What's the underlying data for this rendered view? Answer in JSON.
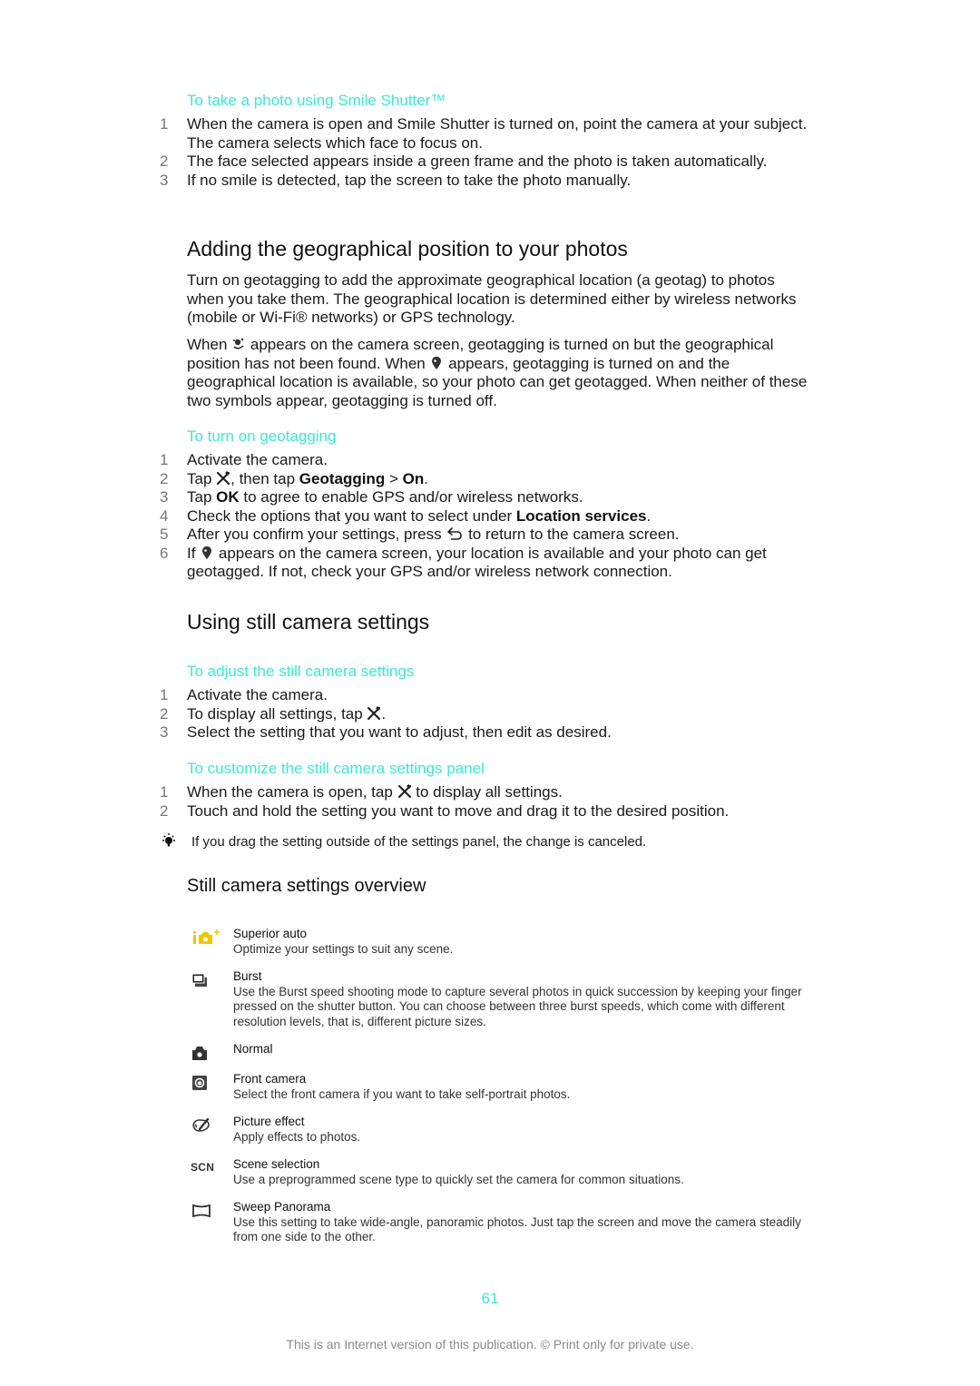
{
  "smile_shutter": {
    "heading": "To take a photo using Smile Shutter™",
    "steps": [
      {
        "num": "1",
        "text": "When the camera is open and Smile Shutter is turned on, point the camera at your subject. The camera selects which face to focus on."
      },
      {
        "num": "2",
        "text": "The face selected appears inside a green frame and the photo is taken automatically."
      },
      {
        "num": "3",
        "text": "If no smile is detected, tap the screen to take the photo manually."
      }
    ]
  },
  "geo_section": {
    "title": "Adding the geographical position to your photos",
    "para1": "Turn on geotagging to add the approximate geographical location (a geotag) to photos when you take them. The geographical location is determined either by wireless networks (mobile or Wi-Fi® networks) or GPS technology.",
    "para2_a": "When ",
    "para2_icon1": "geotag-searching-icon",
    "para2_b": " appears on the camera screen, geotagging is turned on but the geographical position has not been found. When ",
    "para2_icon2": "geotag-found-icon",
    "para2_c": " appears, geotagging is turned on and the geographical location is available, so your photo can get geotagged. When neither of these two symbols appear, geotagging is turned off."
  },
  "turn_on_geo": {
    "heading": "To turn on geotagging",
    "steps": [
      {
        "num": "1",
        "text": "Activate the camera."
      },
      {
        "num": "2",
        "a": "Tap ",
        "icon": "settings-icon",
        "b": ", then tap ",
        "bold1": "Geotagging",
        "c": " > ",
        "bold2": "On",
        "d": "."
      },
      {
        "num": "3",
        "a": "Tap ",
        "bold1": "OK",
        "b": " to agree to enable GPS and/or wireless networks."
      },
      {
        "num": "4",
        "a": "Check the options that you want to select under ",
        "bold1": "Location services",
        "b": "."
      },
      {
        "num": "5",
        "a": "After you confirm your settings, press ",
        "icon": "back-icon",
        "b": " to return to the camera screen."
      },
      {
        "num": "6",
        "a": "If ",
        "icon": "geotag-found-icon",
        "b": " appears on the camera screen, your location is available and your photo can get geotagged. If not, check your GPS and/or wireless network connection."
      }
    ]
  },
  "still_settings": {
    "title": "Using still camera settings",
    "adjust": {
      "heading": "To adjust the still camera settings",
      "steps": [
        {
          "num": "1",
          "text": "Activate the camera."
        },
        {
          "num": "2",
          "a": "To display all settings, tap ",
          "icon": "settings-icon",
          "b": "."
        },
        {
          "num": "3",
          "text": "Select the setting that you want to adjust, then edit as desired."
        }
      ]
    },
    "customize": {
      "heading": "To customize the still camera settings panel",
      "steps": [
        {
          "num": "1",
          "a": "When the camera is open, tap ",
          "icon": "settings-icon",
          "b": " to display all settings."
        },
        {
          "num": "2",
          "text": "Touch and hold the setting you want to move and drag it to the desired position."
        }
      ]
    },
    "tip": {
      "icon": "tip-lightbulb-icon",
      "text": "If you drag the setting outside of the settings panel, the change is canceled."
    }
  },
  "overview": {
    "title": "Still camera settings overview",
    "items": [
      {
        "icon": "superior-auto-icon",
        "name": "Superior auto",
        "desc": "Optimize your settings to suit any scene."
      },
      {
        "icon": "burst-icon",
        "name": "Burst",
        "desc": "Use the Burst speed shooting mode to capture several photos in quick succession by keeping your finger pressed on the shutter button. You can choose between three burst speeds, which come with different resolution levels, that is, different picture sizes."
      },
      {
        "icon": "normal-camera-icon",
        "name": "Normal",
        "desc": ""
      },
      {
        "icon": "front-camera-icon",
        "name": "Front camera",
        "desc": "Select the front camera if you want to take self-portrait photos."
      },
      {
        "icon": "picture-effect-icon",
        "name": "Picture effect",
        "desc": "Apply effects to photos."
      },
      {
        "icon": "scene-selection-icon",
        "name": "Scene selection",
        "desc": "Use a preprogrammed scene type to quickly set the camera for common situations.",
        "icon_text": "SCN"
      },
      {
        "icon": "sweep-panorama-icon",
        "name": "Sweep Panorama",
        "desc": "Use this setting to take wide-angle, panoramic photos. Just tap the screen and move the camera steadily from one side to the other."
      }
    ]
  },
  "footer": {
    "page_number": "61",
    "notice": "This is an Internet version of this publication. © Print only for private use."
  },
  "colors": {
    "accent": "#3ee6d6",
    "superior_auto_icon": "#f5c400"
  }
}
